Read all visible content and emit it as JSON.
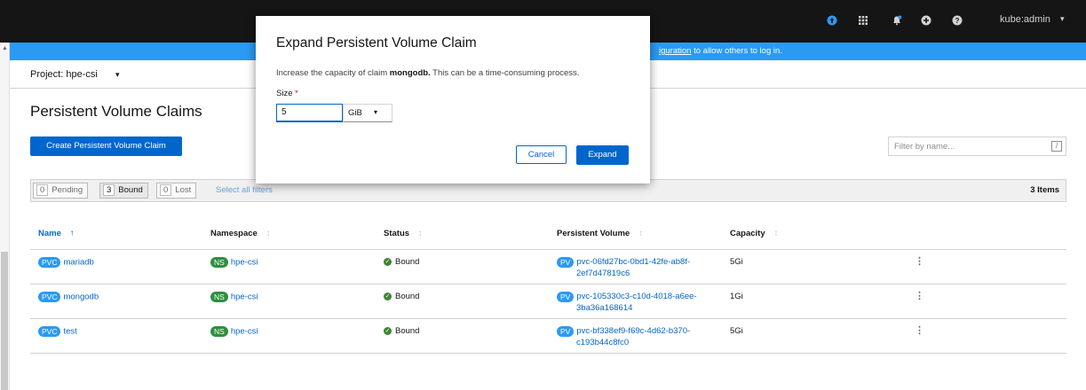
{
  "masthead": {
    "icons": [
      "upload-icon",
      "app-grid-icon",
      "notifications-icon",
      "add-icon",
      "help-icon"
    ],
    "user": "kube:admin",
    "user_caret": "▾"
  },
  "banner": {
    "link": "iguration",
    "text": " to allow others to log in."
  },
  "project": {
    "label": "Project: hpe-csi",
    "caret": "▾"
  },
  "page": {
    "title": "Persistent Volume Claims",
    "create_button": "Create Persistent Volume Claim",
    "filter_placeholder": "Filter by name...",
    "filter_shortcut": "/"
  },
  "filters": {
    "chips": [
      {
        "count": "0",
        "label": "Pending"
      },
      {
        "count": "3",
        "label": "Bound"
      },
      {
        "count": "0",
        "label": "Lost"
      }
    ],
    "select_all": "Select all filters",
    "items_count": "3 Items"
  },
  "table": {
    "headers": [
      "Name",
      "Namespace",
      "Status",
      "Persistent Volume",
      "Capacity"
    ],
    "sort_icons": [
      "↑",
      "↕",
      "↕",
      "↕",
      "↕"
    ],
    "rows": [
      {
        "kind": "PVC",
        "name": "mariadb",
        "ns_badge": "NS",
        "namespace": "hpe-csi",
        "status": "Bound",
        "pv_badge": "PV",
        "pv_line1": "pvc-06fd27bc-0bd1-42fe-ab8f-",
        "pv_line2": "2ef7d47819c6",
        "capacity": "5Gi"
      },
      {
        "kind": "PVC",
        "name": "mongodb",
        "ns_badge": "NS",
        "namespace": "hpe-csi",
        "status": "Bound",
        "pv_badge": "PV",
        "pv_line1": "pvc-105330c3-c10d-4018-a6ee-",
        "pv_line2": "3ba36a168614",
        "capacity": "1Gi"
      },
      {
        "kind": "PVC",
        "name": "test",
        "ns_badge": "NS",
        "namespace": "hpe-csi",
        "status": "Bound",
        "pv_badge": "PV",
        "pv_line1": "pvc-bf338ef9-f69c-4d62-b370-",
        "pv_line2": "c193b44c8fc0",
        "capacity": "5Gi"
      }
    ]
  },
  "modal": {
    "title": "Expand Persistent Volume Claim",
    "desc_prefix": "Increase the capacity of claim ",
    "desc_claim": "mongodb.",
    "desc_suffix": " This can be a time-consuming process.",
    "size_label": "Size",
    "required_mark": "*",
    "size_value": "5",
    "unit": "GiB",
    "unit_caret": "▾",
    "cancel": "Cancel",
    "expand": "Expand"
  },
  "colors": {
    "primary": "#0066cc",
    "banner": "#2b9af3",
    "masthead": "#151515",
    "bound_green": "#3e8635",
    "ns_badge": "#2f8f3e"
  }
}
